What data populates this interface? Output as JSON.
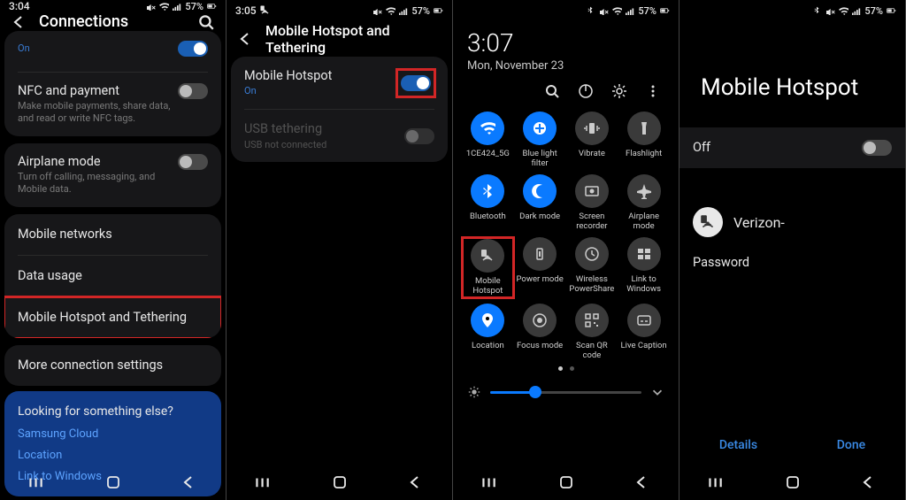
{
  "status": {
    "battery": "57%",
    "times": [
      "3:04",
      "3:05",
      "",
      ""
    ]
  },
  "p1": {
    "title": "Connections",
    "rows": {
      "prev_on": "On",
      "nfc": {
        "label": "NFC and payment",
        "sub": "Make mobile payments, share data, and read or write NFC tags."
      },
      "airplane": {
        "label": "Airplane mode",
        "sub": "Turn off calling, messaging, and Mobile data."
      },
      "mobile_net": "Mobile networks",
      "data_usage": "Data usage",
      "hotspot": "Mobile Hotspot and Tethering",
      "more": "More connection settings"
    },
    "bluecard": {
      "header": "Looking for something else?",
      "links": [
        "Samsung Cloud",
        "Location",
        "Link to Windows"
      ]
    }
  },
  "p2": {
    "title": "Mobile Hotspot and Tethering",
    "hotspot": {
      "label": "Mobile Hotspot",
      "sub": "On"
    },
    "usb": {
      "label": "USB tethering",
      "sub": "USB not connected"
    }
  },
  "p3": {
    "time": "3:07",
    "date": "Mon, November 23",
    "tiles": [
      {
        "label": "1CE424_5G",
        "icon": "wifi",
        "on": true
      },
      {
        "label": "Blue light filter",
        "icon": "bluelight",
        "on": true
      },
      {
        "label": "Vibrate",
        "icon": "vibrate",
        "on": false
      },
      {
        "label": "Flashlight",
        "icon": "flashlight",
        "on": false
      },
      {
        "label": "Bluetooth",
        "icon": "bluetooth",
        "on": true
      },
      {
        "label": "Dark mode",
        "icon": "darkmode",
        "on": true
      },
      {
        "label": "Screen recorder",
        "icon": "screenrec",
        "on": false
      },
      {
        "label": "Airplane mode",
        "icon": "airplane",
        "on": false
      },
      {
        "label": "Mobile Hotspot",
        "icon": "hotspot",
        "on": false,
        "hl": true
      },
      {
        "label": "Power mode",
        "icon": "power",
        "on": false
      },
      {
        "label": "Wireless PowerShare",
        "icon": "powershare",
        "on": false
      },
      {
        "label": "Link to Windows",
        "icon": "windows",
        "on": false
      },
      {
        "label": "Location",
        "icon": "location",
        "on": true
      },
      {
        "label": "Focus mode",
        "icon": "focus",
        "on": false
      },
      {
        "label": "Scan QR code",
        "icon": "qr",
        "on": false
      },
      {
        "label": "Live Caption",
        "icon": "caption",
        "on": false
      }
    ]
  },
  "p4": {
    "title": "Mobile Hotspot",
    "off": "Off",
    "ssid": "Verizon-",
    "pwd_label": "Password",
    "details": "Details",
    "done": "Done"
  }
}
